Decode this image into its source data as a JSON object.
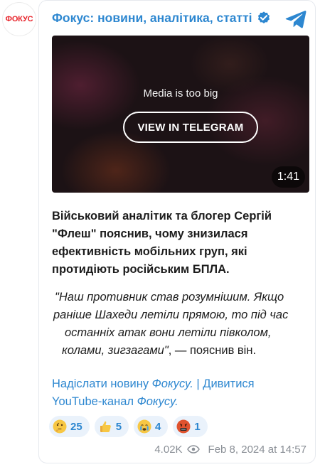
{
  "avatar": {
    "text": "ФОКУС"
  },
  "header": {
    "channel_name": "Фокус: новини, аналітика, статті"
  },
  "media": {
    "message": "Media is too big",
    "button_label": "VIEW IN TELEGRAM",
    "duration": "1:41"
  },
  "post": {
    "lead_lines": [
      "Військовий аналітик та блогер Сергій",
      "\"Флеш\" пояснив, чому знизилася",
      "ефективність мобільних груп, які",
      "протидіють російським БПЛА."
    ],
    "quote_lines": [
      "\"Наш противник став розумнішим. Якщо",
      "раніше Шахеди летіли прямою, то під час",
      "останніх атак вони летіли півколом,",
      "колами, зигзагами\"",
      ", — пояснив він."
    ],
    "links": {
      "link1_text": "Надіслати новину ",
      "link1_italic": "Фокусу.",
      "separator": " | ",
      "link2_text": "Дивитися",
      "link2_line2": "YouTube-канал ",
      "link2_italic": "Фокусу."
    }
  },
  "reactions": [
    {
      "emoji": "thinking-face",
      "count": "25"
    },
    {
      "emoji": "thumbs-up",
      "count": "5"
    },
    {
      "emoji": "crying-face",
      "count": "4"
    },
    {
      "emoji": "angry-cursing-face",
      "count": "1"
    }
  ],
  "footer": {
    "views": "4.02K",
    "date": "Feb 8, 2024 at 14:57"
  },
  "colors": {
    "accent": "#2d87d0",
    "brand_red": "#e8242b",
    "reaction_bg": "#eaf2fb"
  }
}
